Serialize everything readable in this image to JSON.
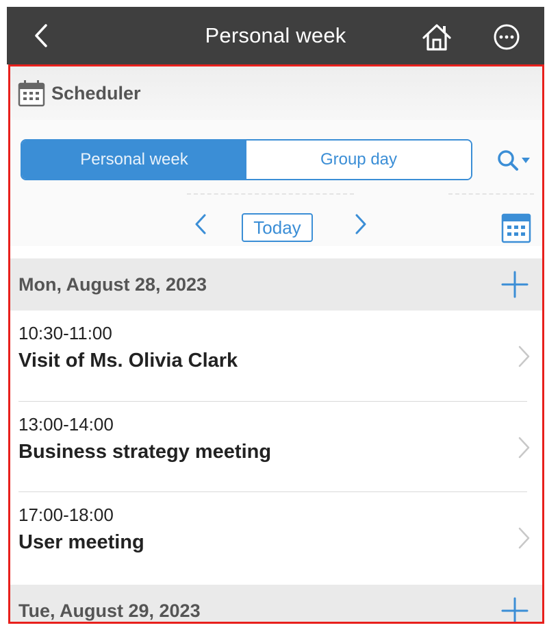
{
  "topbar": {
    "title": "Personal week",
    "back_icon": "chevron-left-icon",
    "home_icon": "home-icon",
    "more_icon": "more-horizontal-icon"
  },
  "scheduler": {
    "label": "Scheduler",
    "icon": "calendar-icon"
  },
  "view_switch": {
    "options": [
      "Personal week",
      "Group day"
    ],
    "selected": "Personal week"
  },
  "navigation": {
    "today_label": "Today"
  },
  "days": [
    {
      "date": "Mon, August 28, 2023",
      "events": [
        {
          "time": "10:30-11:00",
          "title": "Visit of Ms. Olivia Clark"
        },
        {
          "time": "13:00-14:00",
          "title": "Business strategy meeting"
        },
        {
          "time": "17:00-18:00",
          "title": "User meeting"
        }
      ]
    },
    {
      "date": "Tue, August 29, 2023",
      "events": []
    }
  ],
  "colors": {
    "accent": "#3b8ed6",
    "topbar": "#3f3f3f",
    "frame": "#e8201c"
  }
}
